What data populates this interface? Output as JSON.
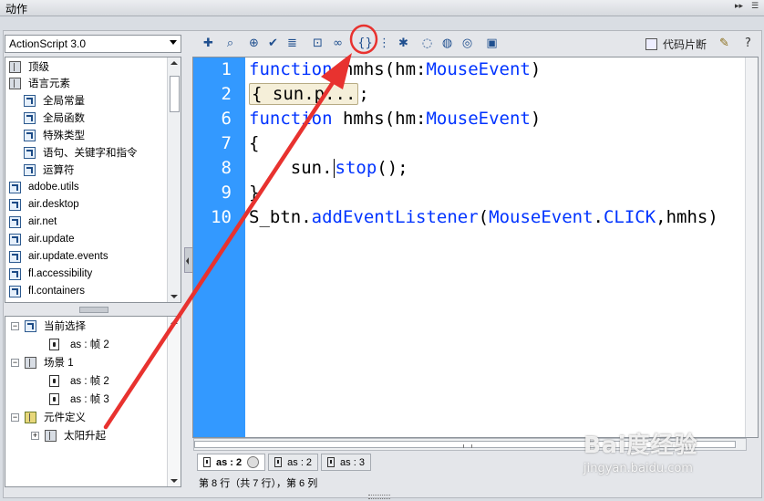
{
  "panel": {
    "title": "动作"
  },
  "language_select": {
    "value": "ActionScript 3.0"
  },
  "toolbox": {
    "items": [
      {
        "label": "顶级"
      },
      {
        "label": "语言元素"
      },
      {
        "label": "全局常量"
      },
      {
        "label": "全局函数"
      },
      {
        "label": "特殊类型"
      },
      {
        "label": "语句、关键字和指令"
      },
      {
        "label": "运算符"
      },
      {
        "label": "adobe.utils"
      },
      {
        "label": "air.desktop"
      },
      {
        "label": "air.net"
      },
      {
        "label": "air.update"
      },
      {
        "label": "air.update.events"
      },
      {
        "label": "fl.accessibility"
      },
      {
        "label": "fl.containers"
      }
    ]
  },
  "script_nav": {
    "items": [
      {
        "label": "当前选择"
      },
      {
        "label": "as : 帧 2"
      },
      {
        "label": "场景 1"
      },
      {
        "label": "as : 帧 2"
      },
      {
        "label": "as : 帧 3"
      },
      {
        "label": "元件定义"
      },
      {
        "label": "太阳升起"
      }
    ]
  },
  "toolbar": {
    "snippets_label": "代码片断",
    "icons": [
      "add-statement-icon",
      "find-icon",
      "target-path-icon",
      "check-syntax-icon",
      "auto-format-icon",
      "show-code-hint-icon",
      "debug-options-icon",
      "collapse-between-braces-icon",
      "collapse-selection-icon",
      "expand-all-icon",
      "apply-block-comment-icon",
      "apply-line-comment-icon",
      "remove-comment-icon",
      "show-hide-toolbox-icon",
      "code-snippets-icon",
      "wizard-icon",
      "help-icon"
    ]
  },
  "code": {
    "line_numbers": [
      "1",
      "2",
      "6",
      "7",
      "8",
      "9",
      "10"
    ],
    "lines": {
      "l1a": "function",
      "l1b": " hmhs(hm:",
      "l1c": "MouseEvent",
      "l1d": ")",
      "l2a": "{ sun.p...",
      "l2b": ";",
      "l3a": "function",
      "l3b": " hmhs(hm:",
      "l3c": "MouseEvent",
      "l3d": ")",
      "l4": "{",
      "l5a": "    sun.",
      "l5b": "stop",
      "l5c": "();",
      "l6": "}",
      "l7a": "S_btn.",
      "l7b": "addEventListener",
      "l7c": "(",
      "l7d": "MouseEvent",
      "l7e": ".",
      "l7f": "CLICK",
      "l7g": ",hmhs)"
    }
  },
  "tabs": [
    {
      "label": "as : 2"
    },
    {
      "label": "as : 2"
    },
    {
      "label": "as : 3"
    }
  ],
  "status": {
    "text": "第 8 行（共 7 行），第 6 列"
  },
  "watermark": {
    "brand": "Bai度经验",
    "url": "jingyan.baidu.com"
  },
  "colors": {
    "gutter": "#3399ff",
    "keyword": "#0033ff",
    "annotation": "#e8322f"
  }
}
